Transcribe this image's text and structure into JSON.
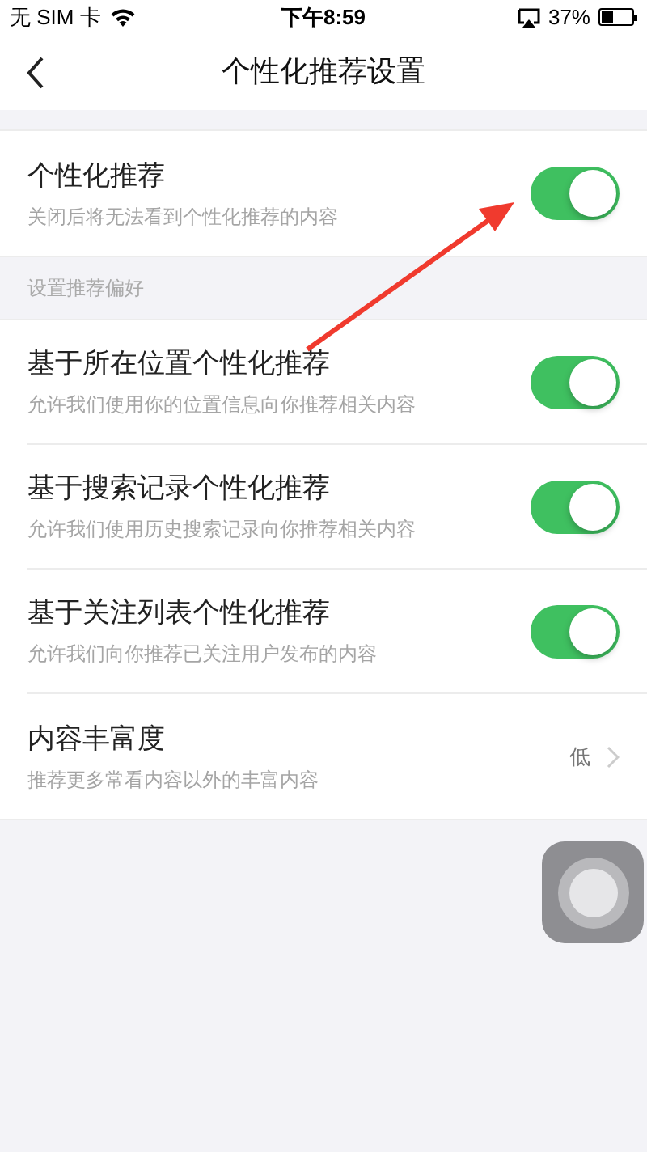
{
  "status_bar": {
    "carrier": "无 SIM 卡",
    "time": "下午8:59",
    "battery": "37%"
  },
  "nav": {
    "title": "个性化推荐设置"
  },
  "main_setting": {
    "kind": "toggle",
    "title": "个性化推荐",
    "subtitle": "关闭后将无法看到个性化推荐的内容",
    "on": true
  },
  "section_header": "设置推荐偏好",
  "settings": [
    {
      "kind": "toggle",
      "title": "基于所在位置个性化推荐",
      "subtitle": "允许我们使用你的位置信息向你推荐相关内容",
      "on": true
    },
    {
      "kind": "toggle",
      "title": "基于搜索记录个性化推荐",
      "subtitle": "允许我们使用历史搜索记录向你推荐相关内容",
      "on": true
    },
    {
      "kind": "toggle",
      "title": "基于关注列表个性化推荐",
      "subtitle": "允许我们向你推荐已关注用户发布的内容",
      "on": true
    },
    {
      "kind": "value",
      "title": "内容丰富度",
      "subtitle": "推荐更多常看内容以外的丰富内容",
      "value": "低"
    }
  ]
}
